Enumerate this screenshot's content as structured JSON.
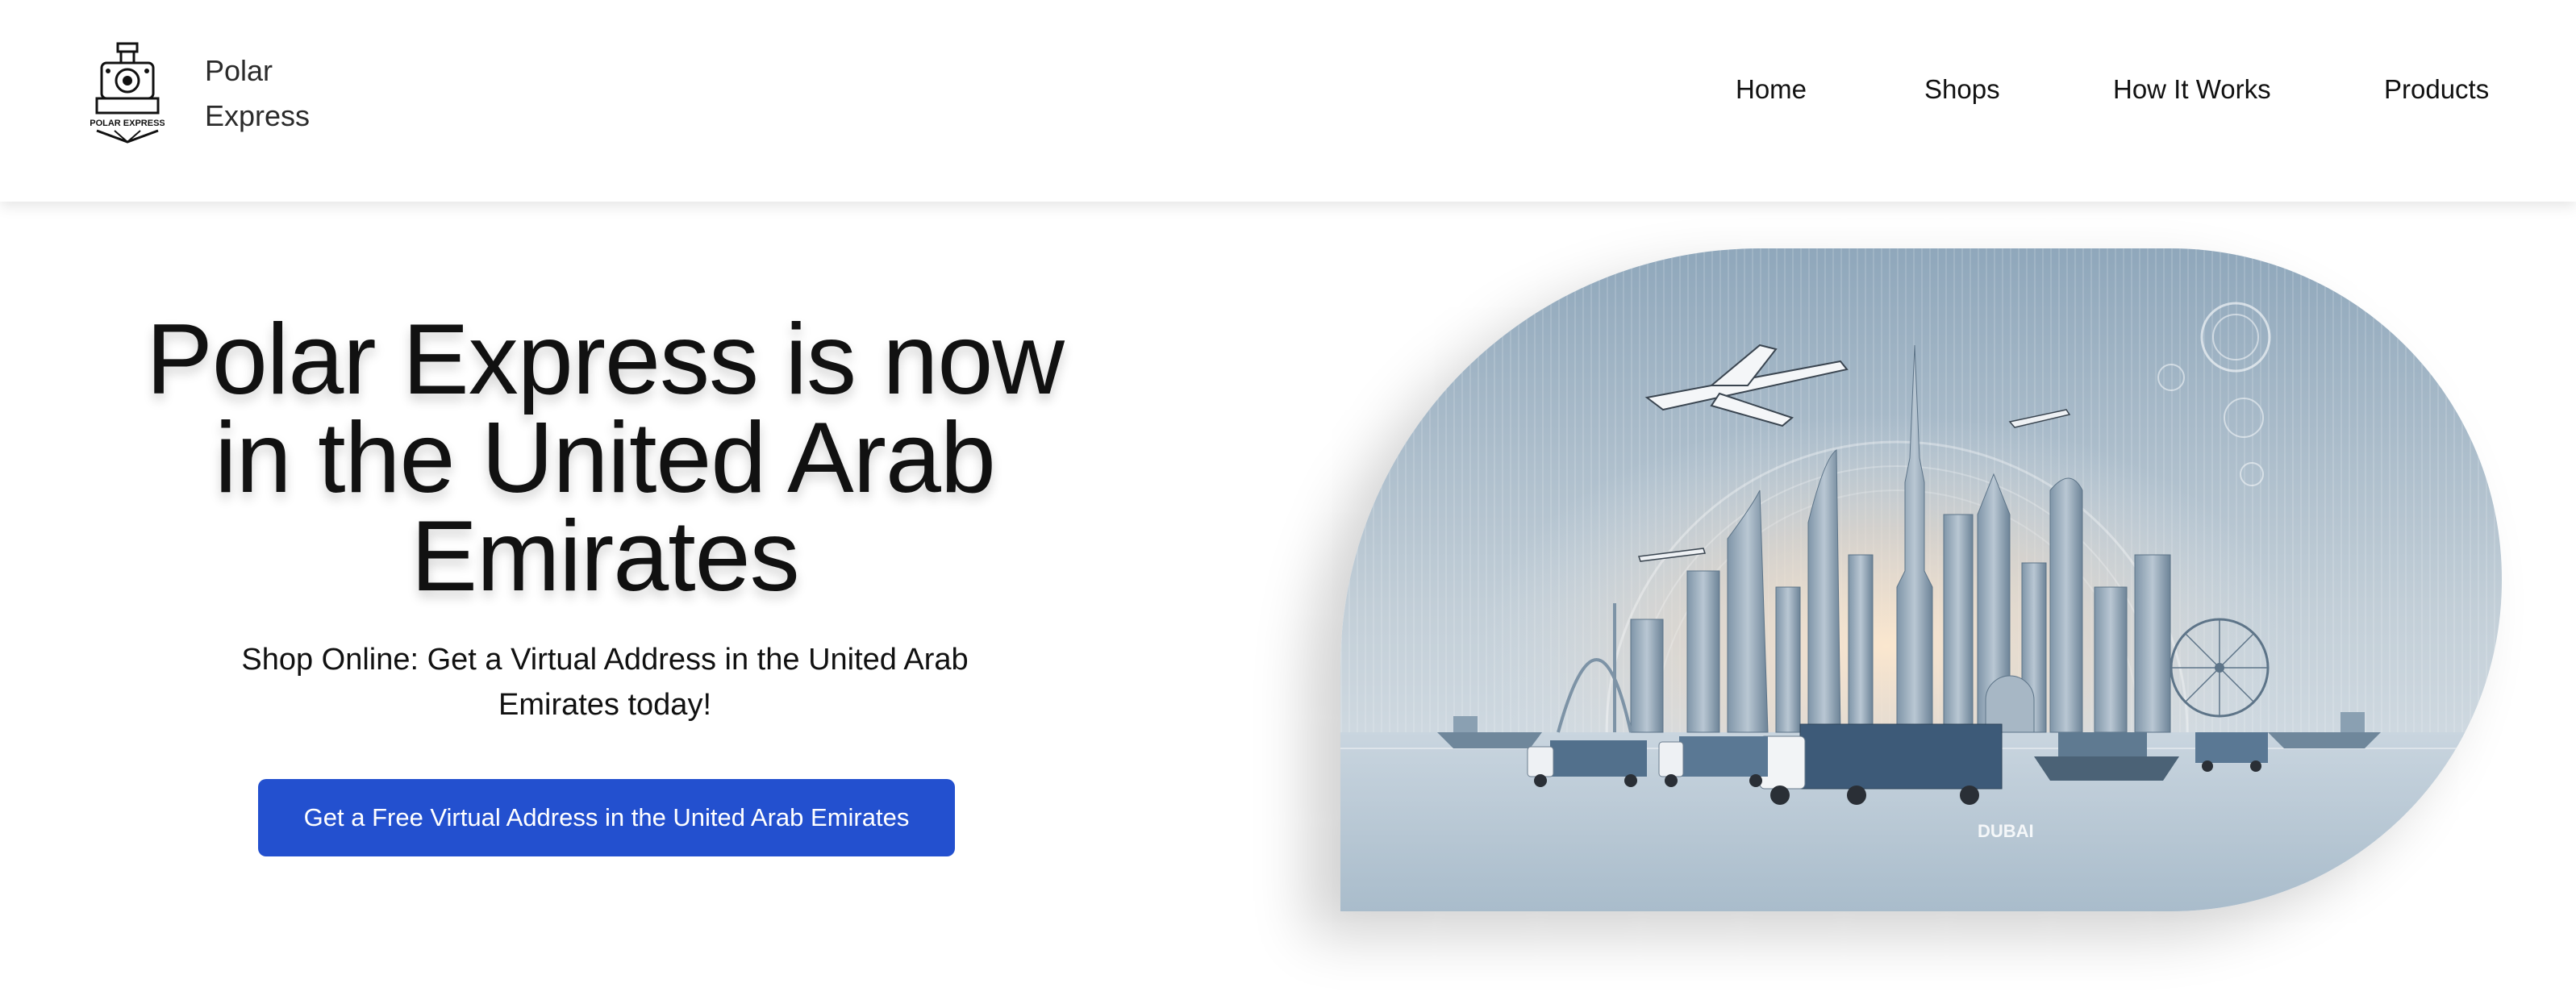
{
  "header": {
    "logo_text": "POLAR EXPRESS",
    "brand_line1": "Polar",
    "brand_line2": "Express",
    "nav": [
      {
        "label": "Home"
      },
      {
        "label": "Shops"
      },
      {
        "label": "How It Works"
      },
      {
        "label": "Products"
      }
    ]
  },
  "hero": {
    "title": "Polar Express is now in the United Arab Emirates",
    "subtitle": "Shop Online: Get a Virtual Address in the United Arab Emirates today!",
    "cta_label": "Get a Free Virtual Address in the United Arab Emirates",
    "image_caption": "DUBAI"
  },
  "colors": {
    "cta": "#2350cf",
    "sky_top": "#8fa7bb",
    "sky_glow": "#f3dcc4"
  }
}
